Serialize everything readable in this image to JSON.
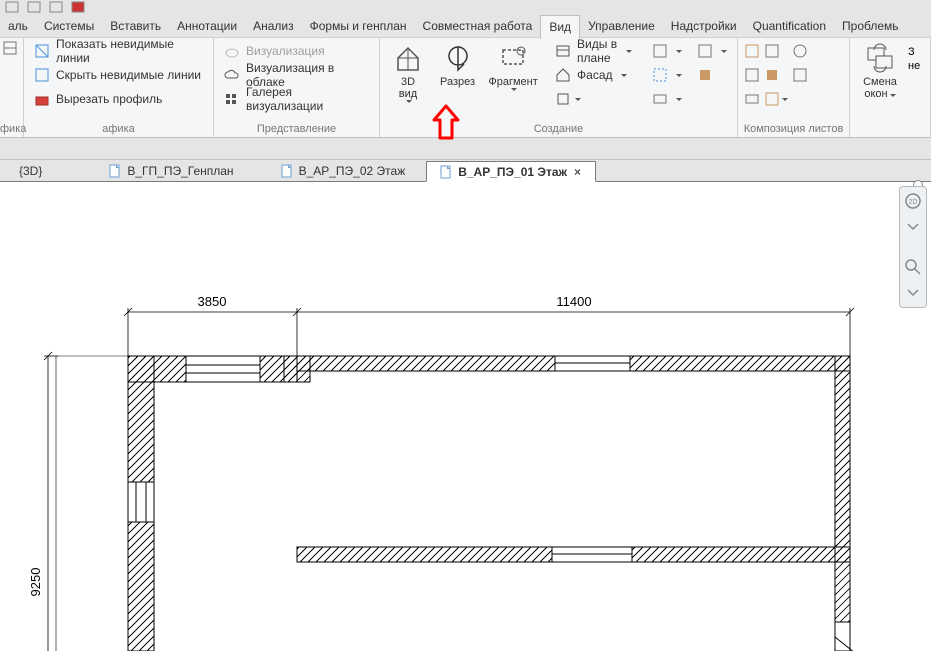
{
  "menubar": [
    {
      "label": "аль",
      "active": false
    },
    {
      "label": "Системы",
      "active": false
    },
    {
      "label": "Вставить",
      "active": false
    },
    {
      "label": "Аннотации",
      "active": false
    },
    {
      "label": "Анализ",
      "active": false
    },
    {
      "label": "Формы и генплан",
      "active": false
    },
    {
      "label": "Совместная работа",
      "active": false
    },
    {
      "label": "Вид",
      "active": true
    },
    {
      "label": "Управление",
      "active": false
    },
    {
      "label": "Надстройки",
      "active": false
    },
    {
      "label": "Quantification",
      "active": false
    },
    {
      "label": "Проблемь",
      "active": false
    }
  ],
  "ribbon": {
    "panel1": {
      "title": "афика",
      "items": [
        "Показать невидимые линии",
        "Скрыть невидимые линии",
        "Вырезать профиль"
      ]
    },
    "panel2": {
      "title": "Представление",
      "items": [
        "Визуализация",
        "Визуализация  в облаке",
        "Галерея  визуализации"
      ]
    },
    "panel3": {
      "big": [
        {
          "label": "3D вид"
        },
        {
          "label": "Разрез"
        },
        {
          "label": "Фрагмент"
        }
      ],
      "sm": [
        {
          "label": "Виды в плане"
        },
        {
          "label": "Фасад"
        }
      ],
      "title": "Создание"
    },
    "panel4": {
      "title": "Композиция листов"
    },
    "panel5": {
      "l1": "Смена",
      "l2": "окон",
      "l3": "З",
      "l4": "не"
    }
  },
  "tabs": [
    {
      "label": "{3D}",
      "active": false,
      "icon": false
    },
    {
      "label": "В_ГП_ПЭ_Генплан",
      "active": false,
      "icon": true
    },
    {
      "label": "В_АР_ПЭ_02 Этаж",
      "active": false,
      "icon": true
    },
    {
      "label": "В_АР_ПЭ_01 Этаж",
      "active": true,
      "icon": true
    }
  ],
  "dimensions": {
    "top1": "3850",
    "top2": "11400",
    "left": "9250"
  }
}
